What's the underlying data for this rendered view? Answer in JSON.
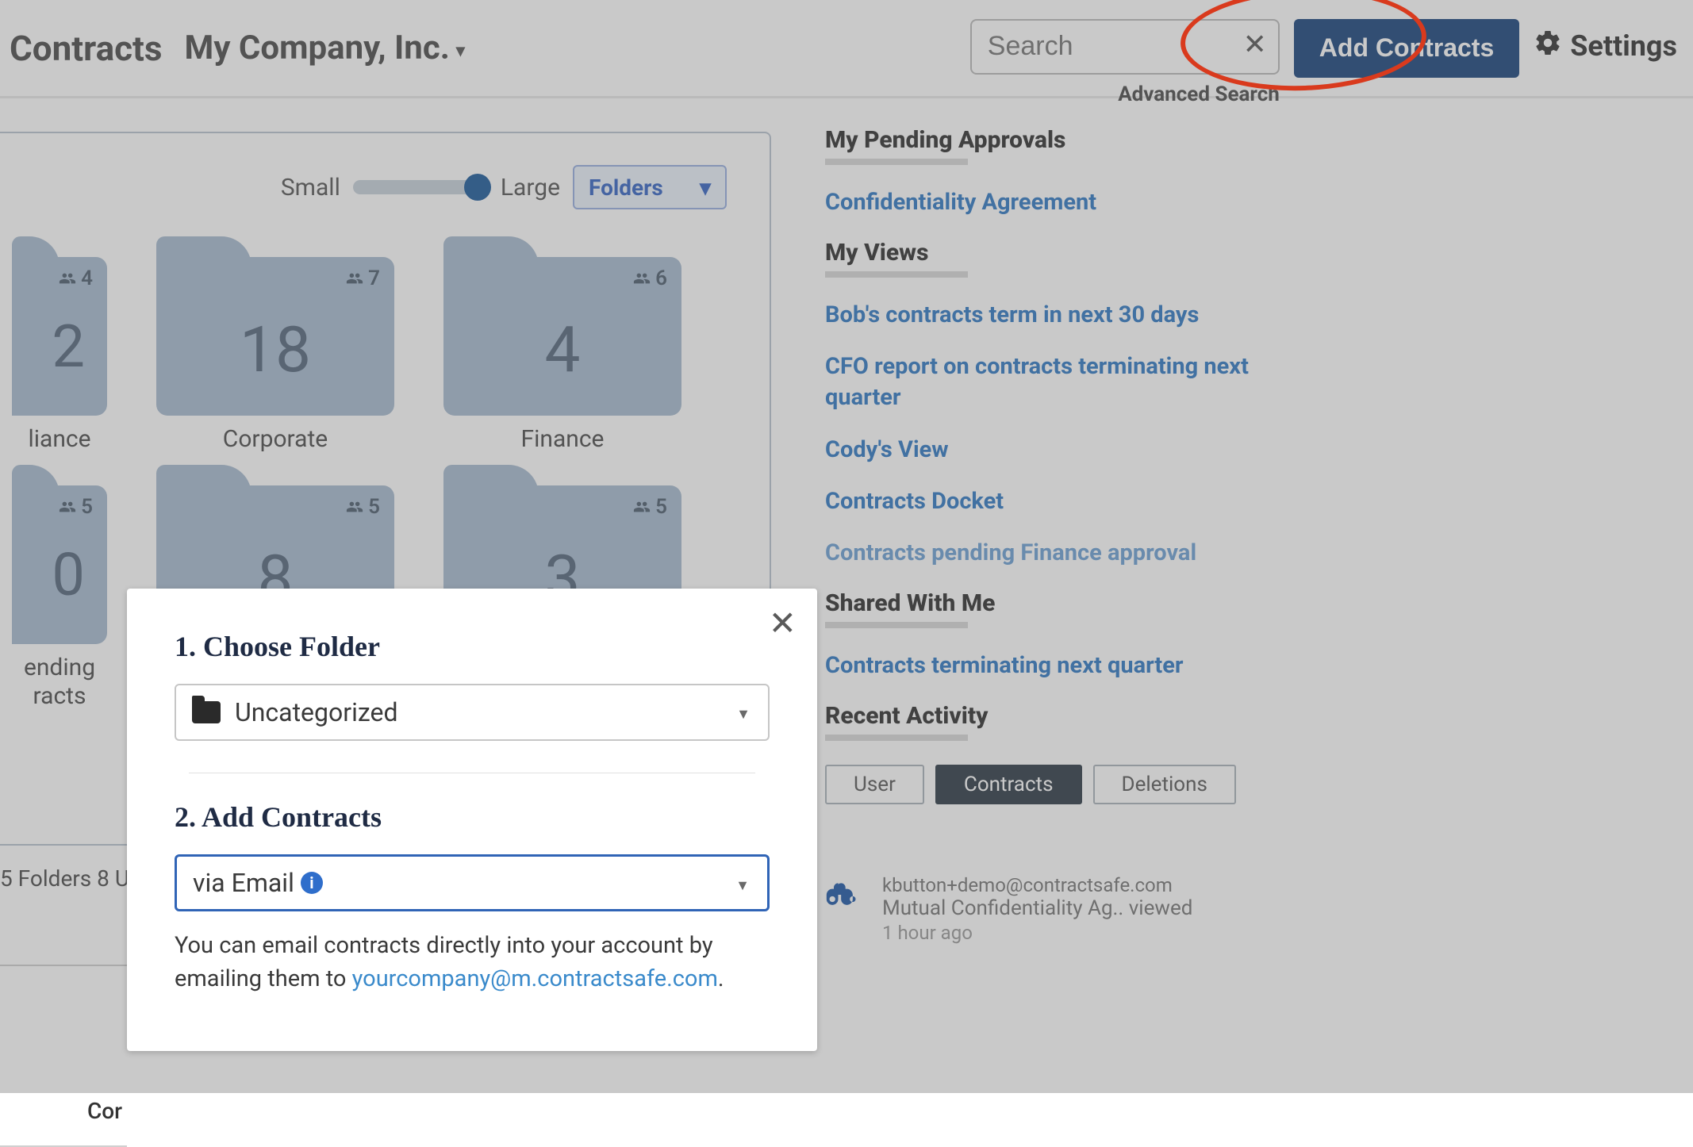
{
  "header": {
    "brand": "Contracts",
    "company": "My Company, Inc.",
    "search_placeholder": "Search",
    "advanced_search": "Advanced Search",
    "add_contracts": "Add Contracts",
    "settings": "Settings"
  },
  "folders_panel": {
    "small_label": "Small",
    "large_label": "Large",
    "view_select": "Folders",
    "footer": "5 Folders  8 U",
    "items": [
      {
        "name": "liance",
        "count": "2",
        "people": "4",
        "edge": true
      },
      {
        "name": "Corporate",
        "count": "18",
        "people": "7"
      },
      {
        "name": "Finance",
        "count": "4",
        "people": "6"
      },
      {
        "name": "ending\nracts",
        "count": "0",
        "people": "5",
        "edge": true
      },
      {
        "name": "",
        "count": "8",
        "people": "5"
      },
      {
        "name": "",
        "count": "3",
        "people": "5"
      }
    ]
  },
  "bottom_tab": "Cor",
  "sidebar": {
    "pending_h": "My Pending Approvals",
    "pending_items": [
      "Confidentiality Agreement"
    ],
    "views_h": "My Views",
    "views_items": [
      "Bob's contracts term in next 30 days",
      "CFO report on contracts terminating next quarter",
      "Cody's View",
      "Contracts Docket",
      "Contracts pending Finance approval"
    ],
    "shared_h": "Shared With Me",
    "shared_items": [
      "Contracts terminating next quarter"
    ],
    "recent_h": "Recent Activity",
    "pills": {
      "user": "User",
      "contracts": "Contracts",
      "deletions": "Deletions"
    },
    "activity": {
      "user": "kbutton+demo@contractsafe.com",
      "title": "Mutual Confidentiality Ag.. viewed",
      "time": "1 hour ago"
    }
  },
  "modal": {
    "step1": "1. Choose Folder",
    "folder_value": "Uncategorized",
    "step2": "2. Add Contracts",
    "method_value": "via Email",
    "help_pre": "You can email contracts directly into your account by emailing them to ",
    "help_link": "yourcompany@m.contractsafe.com",
    "help_post": "."
  }
}
